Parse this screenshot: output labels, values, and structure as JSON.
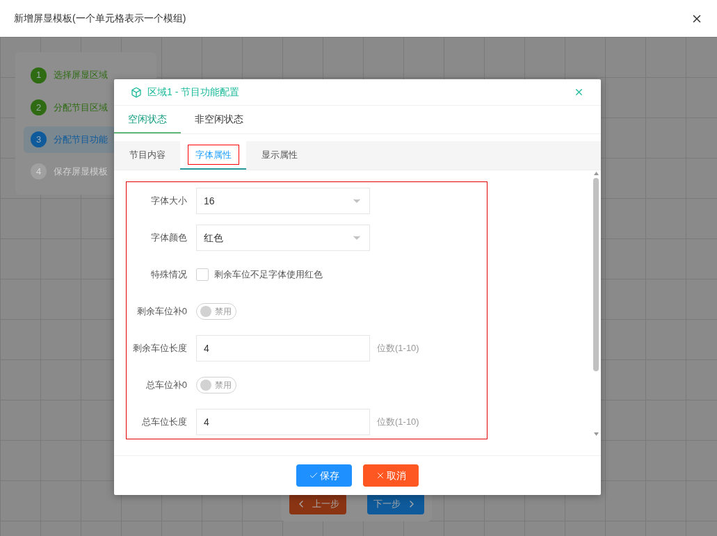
{
  "window": {
    "title": "新增屏显模板(一个单元格表示一个模组)"
  },
  "steps": [
    {
      "number": "1",
      "label": "选择屏显区域",
      "done": true,
      "selected": false
    },
    {
      "number": "2",
      "label": "分配节目区域",
      "done": true,
      "selected": false
    },
    {
      "number": "3",
      "label": "分配节目功能",
      "done": false,
      "selected": true
    },
    {
      "number": "4",
      "label": "保存屏显模板",
      "done": false,
      "selected": false
    }
  ],
  "nav": {
    "prev": "上一步",
    "next": "下一步"
  },
  "dialog": {
    "title": "区域1 - 节目功能配置",
    "tabs": [
      {
        "label": "空闲状态",
        "selected": true
      },
      {
        "label": "非空闲状态",
        "selected": false
      }
    ],
    "sub_tabs": [
      {
        "label": "节目内容",
        "selected": false,
        "annotated": false
      },
      {
        "label": "字体属性",
        "selected": true,
        "annotated": true
      },
      {
        "label": "显示属性",
        "selected": false,
        "annotated": false
      }
    ],
    "form": {
      "annotated": true,
      "fields": [
        {
          "kind": "select",
          "label": "字体大小",
          "value": "16"
        },
        {
          "kind": "select",
          "label": "字体颜色",
          "value": "红色"
        },
        {
          "kind": "checkbox",
          "label": "特殊情况",
          "text": "剩余车位不足字体使用红色",
          "checked": false
        },
        {
          "kind": "switch",
          "label": "剩余车位补0",
          "text": "禁用",
          "on": false
        },
        {
          "kind": "input",
          "label": "剩余车位长度",
          "value": "4",
          "hint": "位数(1-10)"
        },
        {
          "kind": "switch",
          "label": "总车位补0",
          "text": "禁用",
          "on": false
        },
        {
          "kind": "input",
          "label": "总车位长度",
          "value": "4",
          "hint": "位数(1-10)"
        }
      ]
    },
    "buttons": [
      {
        "label": "保存",
        "kind": "save"
      },
      {
        "label": "取消",
        "kind": "cancel"
      }
    ]
  }
}
